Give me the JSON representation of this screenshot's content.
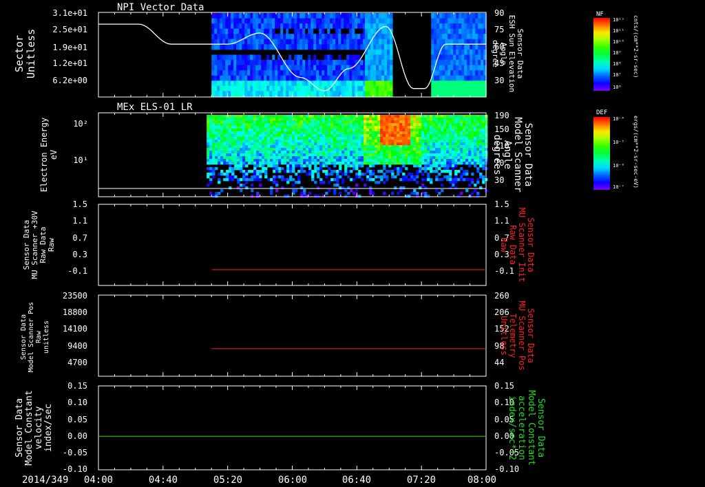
{
  "date_label": "2014/349",
  "time_ticks": [
    "04:00",
    "04:40",
    "05:20",
    "06:00",
    "06:40",
    "07:20",
    "08:00"
  ],
  "colors": {
    "white": "#ffffff",
    "red": "#ff2020",
    "green": "#22dd22",
    "axis": "#ffffff"
  },
  "chart_data": [
    {
      "type": "heatmap",
      "title": "NPI Vector Data",
      "ylabel_left": [
        "Sector",
        "Unitless"
      ],
      "ylabel_right": [
        "Sensor Data",
        "ESH Sun Elevation",
        "Angle",
        "degree"
      ],
      "left_ticks": [
        "3.1e+01",
        "2.5e+01",
        "1.9e+01",
        "1.2e+01",
        "6.2e+00"
      ],
      "right_ticks": [
        "90",
        "75",
        "60",
        "45",
        "30"
      ],
      "right_ylim": [
        15,
        90
      ],
      "colorbar": {
        "label": "NF",
        "unit": "cnts/(cm**2-sr-sec)",
        "ticks": [
          "10¹²",
          "10¹¹",
          "10¹⁰",
          "10⁹",
          "10⁸",
          "10⁷",
          "10⁶"
        ]
      },
      "sun_elevation": {
        "x": [
          "04:00",
          "04:25",
          "04:45",
          "05:20",
          "05:40",
          "06:05",
          "06:20",
          "06:35",
          "06:58",
          "07:15",
          "07:22",
          "07:35",
          "08:00"
        ],
        "y": [
          80,
          80,
          62,
          62,
          72,
          32,
          20,
          40,
          78,
          22,
          22,
          62,
          62
        ]
      }
    },
    {
      "type": "heatmap",
      "title": "MEx ELS-01 LR",
      "ylabel_left": [
        "Electron Energy",
        "eV"
      ],
      "ylabel_right": [
        "Sensor Data",
        "Model Scanner",
        "Angle",
        "degrees"
      ],
      "left_ticks": [
        "10²",
        "10¹"
      ],
      "right_ticks": [
        "190",
        "150",
        "110",
        "70",
        "30"
      ],
      "right_ylim": [
        0,
        190
      ],
      "colorbar": {
        "label": "DEF",
        "unit": "ergs/(cm**2-sr-sec-eV)",
        "ticks": [
          "10⁻⁴",
          "10⁻⁵",
          "10⁻⁶",
          "10⁻⁷"
        ]
      }
    },
    {
      "type": "line",
      "ylabel_left": [
        "Sensor Data",
        "MU Scanner +30V",
        "Raw Data",
        "Raw"
      ],
      "ylabel_right": [
        "Sensor Data",
        "MU Scanner Init",
        "Raw Data",
        "Raw"
      ],
      "left_ticks": [
        "1.5",
        "1.1",
        "0.7",
        "0.3",
        "-0.1"
      ],
      "right_ticks": [
        "1.5",
        "1.1",
        "0.7",
        "0.3",
        "-0.1"
      ],
      "ylim": [
        -0.4,
        1.5
      ],
      "series": [
        {
          "x": [
            "05:10",
            "08:00"
          ],
          "y": [
            -0.03,
            -0.03
          ]
        }
      ]
    },
    {
      "type": "line",
      "ylabel_left": [
        "Sensor Data",
        "Model Scanner Pos",
        "Raw",
        "unitless"
      ],
      "ylabel_right": [
        "Sensor Data",
        "MU Scanner Pos",
        "Telemetry",
        "Unitless"
      ],
      "left_ticks": [
        "23500",
        "18800",
        "14100",
        "9400",
        "4700"
      ],
      "right_ticks": [
        "260",
        "206",
        "152",
        "98",
        "44"
      ],
      "ylim": [
        0,
        23500
      ],
      "series": [
        {
          "x": [
            "05:10",
            "08:00"
          ],
          "y": [
            8000,
            8000
          ]
        }
      ]
    },
    {
      "type": "line",
      "ylabel_left": [
        "Sensor Data",
        "Model Constant",
        "velocity",
        "index/sec"
      ],
      "ylabel_right": [
        "Sensor Data",
        "Model Constant",
        "acceleration",
        "index/sec**2"
      ],
      "left_ticks": [
        "0.15",
        "0.10",
        "0.05",
        "0.00",
        "-0.05",
        "-0.10"
      ],
      "right_ticks": [
        "0.15",
        "0.10",
        "0.05",
        "0.00",
        "-0.05",
        "-0.10"
      ],
      "ylim": [
        -0.1,
        0.15
      ],
      "series": [
        {
          "x": [
            "04:00",
            "08:00"
          ],
          "y": [
            0.0,
            0.0
          ]
        }
      ]
    }
  ]
}
